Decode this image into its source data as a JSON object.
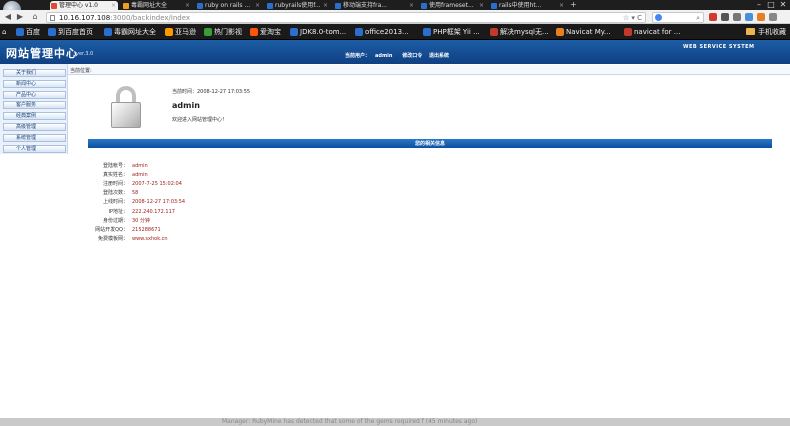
{
  "browser": {
    "tabs": [
      {
        "label": "管理中心 v1.0",
        "active": true,
        "color": "#e04b35"
      },
      {
        "label": "毒霸网址大全",
        "active": false,
        "color": "#f0a020"
      },
      {
        "label": "ruby on rails ...",
        "active": false,
        "color": "#2a6fd0"
      },
      {
        "label": "rubyrails使用f...",
        "active": false,
        "color": "#2a6fd0"
      },
      {
        "label": "移动端支持fra...",
        "active": false,
        "color": "#2a6fd0"
      },
      {
        "label": "使用frameset...",
        "active": false,
        "color": "#2a6fd0"
      },
      {
        "label": "rails中使用ht...",
        "active": false,
        "color": "#2a6fd0"
      }
    ],
    "url_host": "10.16.107.108",
    "url_path": ":3000/backindex/index",
    "bookmarks": [
      {
        "label": "百度",
        "color": "#2a6fd0"
      },
      {
        "label": "到百度首页",
        "color": "#2a6fd0"
      },
      {
        "label": "毒霸网址大全",
        "color": "#2a6fd0"
      },
      {
        "label": "亚马逊",
        "color": "#ff9900"
      },
      {
        "label": "热门影视",
        "color": "#3a9d3a"
      },
      {
        "label": "爱淘宝",
        "color": "#ff5500"
      },
      {
        "label": "JDK8.0-tom...",
        "color": "#2a6fd0"
      },
      {
        "label": "office2013...",
        "color": "#2a6fd0"
      },
      {
        "label": "PHP框架 Yii ...",
        "color": "#2a6fd0"
      },
      {
        "label": "解决mysql无...",
        "color": "#c0392b"
      },
      {
        "label": "Navicat My...",
        "color": "#e67e22"
      },
      {
        "label": "navicat for ...",
        "color": "#c0392b"
      }
    ],
    "mobile_bookmarks": "手机收藏"
  },
  "header": {
    "title": "网站管理中心",
    "version": "ver.3.0",
    "current_user_label": "当前用户：",
    "current_user": "admin",
    "change_password": "修改口令",
    "logout": "退出系统",
    "badge": "WEB SERVICE SYSTEM"
  },
  "sidebar": {
    "items": [
      {
        "label": "关于我们"
      },
      {
        "label": "新闻中心"
      },
      {
        "label": "产品中心"
      },
      {
        "label": "客户服务"
      },
      {
        "label": "经典案例"
      },
      {
        "label": "高级管理"
      },
      {
        "label": "系统管理"
      },
      {
        "label": "个人管理"
      }
    ]
  },
  "main": {
    "location_label": "当前位置:",
    "login_time": "当前时间：2008-12-27 17:03:55",
    "welcome_name": "admin",
    "welcome_msg": "欢迎进入网站管理中心！",
    "info_title": "您的相关信息",
    "info": [
      {
        "key": "登陆帐号：",
        "value": "admin"
      },
      {
        "key": "真实姓名：",
        "value": "admin"
      },
      {
        "key": "注册时间：",
        "value": "2007-7-25 15:02:04"
      },
      {
        "key": "登陆次数：",
        "value": "58"
      },
      {
        "key": "上线时间：",
        "value": "2008-12-27 17:03:54"
      },
      {
        "key": "IP地址：",
        "value": "222.240.172.117"
      },
      {
        "key": "身份过期：",
        "value": "30 分钟"
      },
      {
        "key": "网站开发QQ：",
        "value": "215288671"
      },
      {
        "key": "免费模板网：",
        "value": "www.sxhok.cn"
      }
    ]
  },
  "bottom_text": "Manager: RubyMine has detected that some of the gems required f (45 minutes ago)"
}
